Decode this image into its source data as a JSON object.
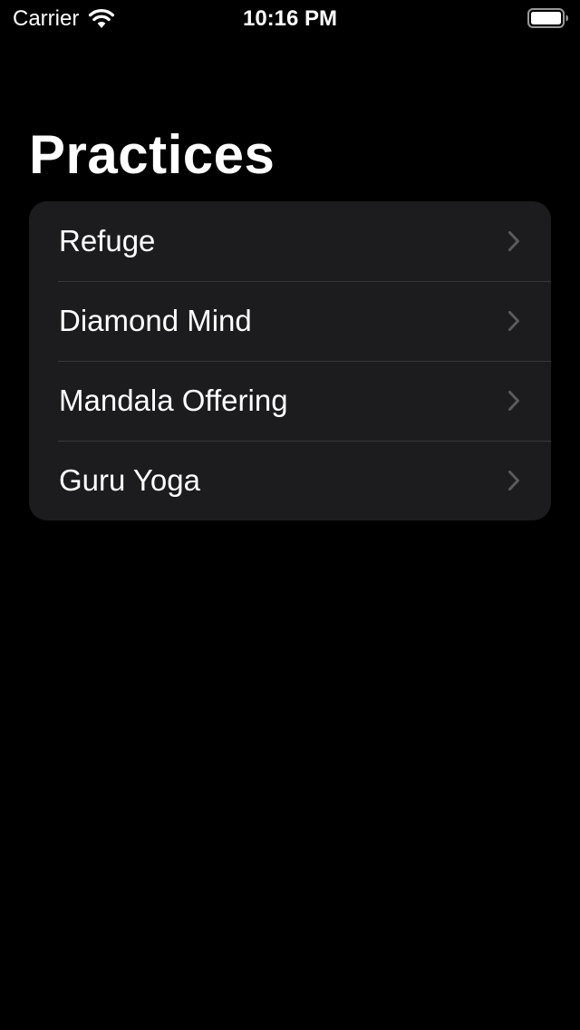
{
  "status_bar": {
    "carrier": "Carrier",
    "time": "10:16 PM",
    "icons": [
      "wifi-icon",
      "battery-icon"
    ]
  },
  "title": "Practices",
  "practices": [
    {
      "label": "Refuge",
      "icon": "chevron-right-icon"
    },
    {
      "label": "Diamond Mind",
      "icon": "chevron-right-icon"
    },
    {
      "label": "Mandala Offering",
      "icon": "chevron-right-icon"
    },
    {
      "label": "Guru Yoga",
      "icon": "chevron-right-icon"
    }
  ],
  "colors": {
    "background": "#000000",
    "card": "#1c1c1e",
    "separator": "#38383a",
    "text": "#ffffff",
    "chevron": "#5a5a5f"
  }
}
